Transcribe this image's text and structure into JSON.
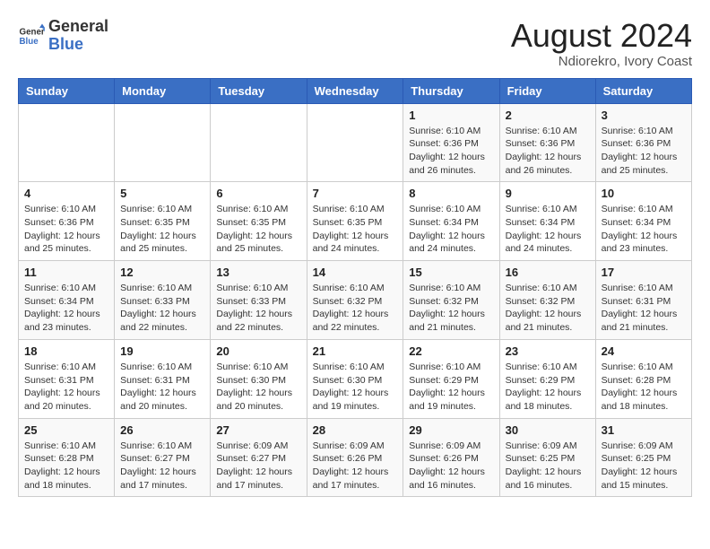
{
  "header": {
    "logo_line1": "General",
    "logo_line2": "Blue",
    "month_year": "August 2024",
    "location": "Ndiorekro, Ivory Coast"
  },
  "weekdays": [
    "Sunday",
    "Monday",
    "Tuesday",
    "Wednesday",
    "Thursday",
    "Friday",
    "Saturday"
  ],
  "weeks": [
    [
      {
        "day": "",
        "info": ""
      },
      {
        "day": "",
        "info": ""
      },
      {
        "day": "",
        "info": ""
      },
      {
        "day": "",
        "info": ""
      },
      {
        "day": "1",
        "info": "Sunrise: 6:10 AM\nSunset: 6:36 PM\nDaylight: 12 hours\nand 26 minutes."
      },
      {
        "day": "2",
        "info": "Sunrise: 6:10 AM\nSunset: 6:36 PM\nDaylight: 12 hours\nand 26 minutes."
      },
      {
        "day": "3",
        "info": "Sunrise: 6:10 AM\nSunset: 6:36 PM\nDaylight: 12 hours\nand 25 minutes."
      }
    ],
    [
      {
        "day": "4",
        "info": "Sunrise: 6:10 AM\nSunset: 6:36 PM\nDaylight: 12 hours\nand 25 minutes."
      },
      {
        "day": "5",
        "info": "Sunrise: 6:10 AM\nSunset: 6:35 PM\nDaylight: 12 hours\nand 25 minutes."
      },
      {
        "day": "6",
        "info": "Sunrise: 6:10 AM\nSunset: 6:35 PM\nDaylight: 12 hours\nand 25 minutes."
      },
      {
        "day": "7",
        "info": "Sunrise: 6:10 AM\nSunset: 6:35 PM\nDaylight: 12 hours\nand 24 minutes."
      },
      {
        "day": "8",
        "info": "Sunrise: 6:10 AM\nSunset: 6:34 PM\nDaylight: 12 hours\nand 24 minutes."
      },
      {
        "day": "9",
        "info": "Sunrise: 6:10 AM\nSunset: 6:34 PM\nDaylight: 12 hours\nand 24 minutes."
      },
      {
        "day": "10",
        "info": "Sunrise: 6:10 AM\nSunset: 6:34 PM\nDaylight: 12 hours\nand 23 minutes."
      }
    ],
    [
      {
        "day": "11",
        "info": "Sunrise: 6:10 AM\nSunset: 6:34 PM\nDaylight: 12 hours\nand 23 minutes."
      },
      {
        "day": "12",
        "info": "Sunrise: 6:10 AM\nSunset: 6:33 PM\nDaylight: 12 hours\nand 22 minutes."
      },
      {
        "day": "13",
        "info": "Sunrise: 6:10 AM\nSunset: 6:33 PM\nDaylight: 12 hours\nand 22 minutes."
      },
      {
        "day": "14",
        "info": "Sunrise: 6:10 AM\nSunset: 6:32 PM\nDaylight: 12 hours\nand 22 minutes."
      },
      {
        "day": "15",
        "info": "Sunrise: 6:10 AM\nSunset: 6:32 PM\nDaylight: 12 hours\nand 21 minutes."
      },
      {
        "day": "16",
        "info": "Sunrise: 6:10 AM\nSunset: 6:32 PM\nDaylight: 12 hours\nand 21 minutes."
      },
      {
        "day": "17",
        "info": "Sunrise: 6:10 AM\nSunset: 6:31 PM\nDaylight: 12 hours\nand 21 minutes."
      }
    ],
    [
      {
        "day": "18",
        "info": "Sunrise: 6:10 AM\nSunset: 6:31 PM\nDaylight: 12 hours\nand 20 minutes."
      },
      {
        "day": "19",
        "info": "Sunrise: 6:10 AM\nSunset: 6:31 PM\nDaylight: 12 hours\nand 20 minutes."
      },
      {
        "day": "20",
        "info": "Sunrise: 6:10 AM\nSunset: 6:30 PM\nDaylight: 12 hours\nand 20 minutes."
      },
      {
        "day": "21",
        "info": "Sunrise: 6:10 AM\nSunset: 6:30 PM\nDaylight: 12 hours\nand 19 minutes."
      },
      {
        "day": "22",
        "info": "Sunrise: 6:10 AM\nSunset: 6:29 PM\nDaylight: 12 hours\nand 19 minutes."
      },
      {
        "day": "23",
        "info": "Sunrise: 6:10 AM\nSunset: 6:29 PM\nDaylight: 12 hours\nand 18 minutes."
      },
      {
        "day": "24",
        "info": "Sunrise: 6:10 AM\nSunset: 6:28 PM\nDaylight: 12 hours\nand 18 minutes."
      }
    ],
    [
      {
        "day": "25",
        "info": "Sunrise: 6:10 AM\nSunset: 6:28 PM\nDaylight: 12 hours\nand 18 minutes."
      },
      {
        "day": "26",
        "info": "Sunrise: 6:10 AM\nSunset: 6:27 PM\nDaylight: 12 hours\nand 17 minutes."
      },
      {
        "day": "27",
        "info": "Sunrise: 6:09 AM\nSunset: 6:27 PM\nDaylight: 12 hours\nand 17 minutes."
      },
      {
        "day": "28",
        "info": "Sunrise: 6:09 AM\nSunset: 6:26 PM\nDaylight: 12 hours\nand 17 minutes."
      },
      {
        "day": "29",
        "info": "Sunrise: 6:09 AM\nSunset: 6:26 PM\nDaylight: 12 hours\nand 16 minutes."
      },
      {
        "day": "30",
        "info": "Sunrise: 6:09 AM\nSunset: 6:25 PM\nDaylight: 12 hours\nand 16 minutes."
      },
      {
        "day": "31",
        "info": "Sunrise: 6:09 AM\nSunset: 6:25 PM\nDaylight: 12 hours\nand 15 minutes."
      }
    ]
  ]
}
